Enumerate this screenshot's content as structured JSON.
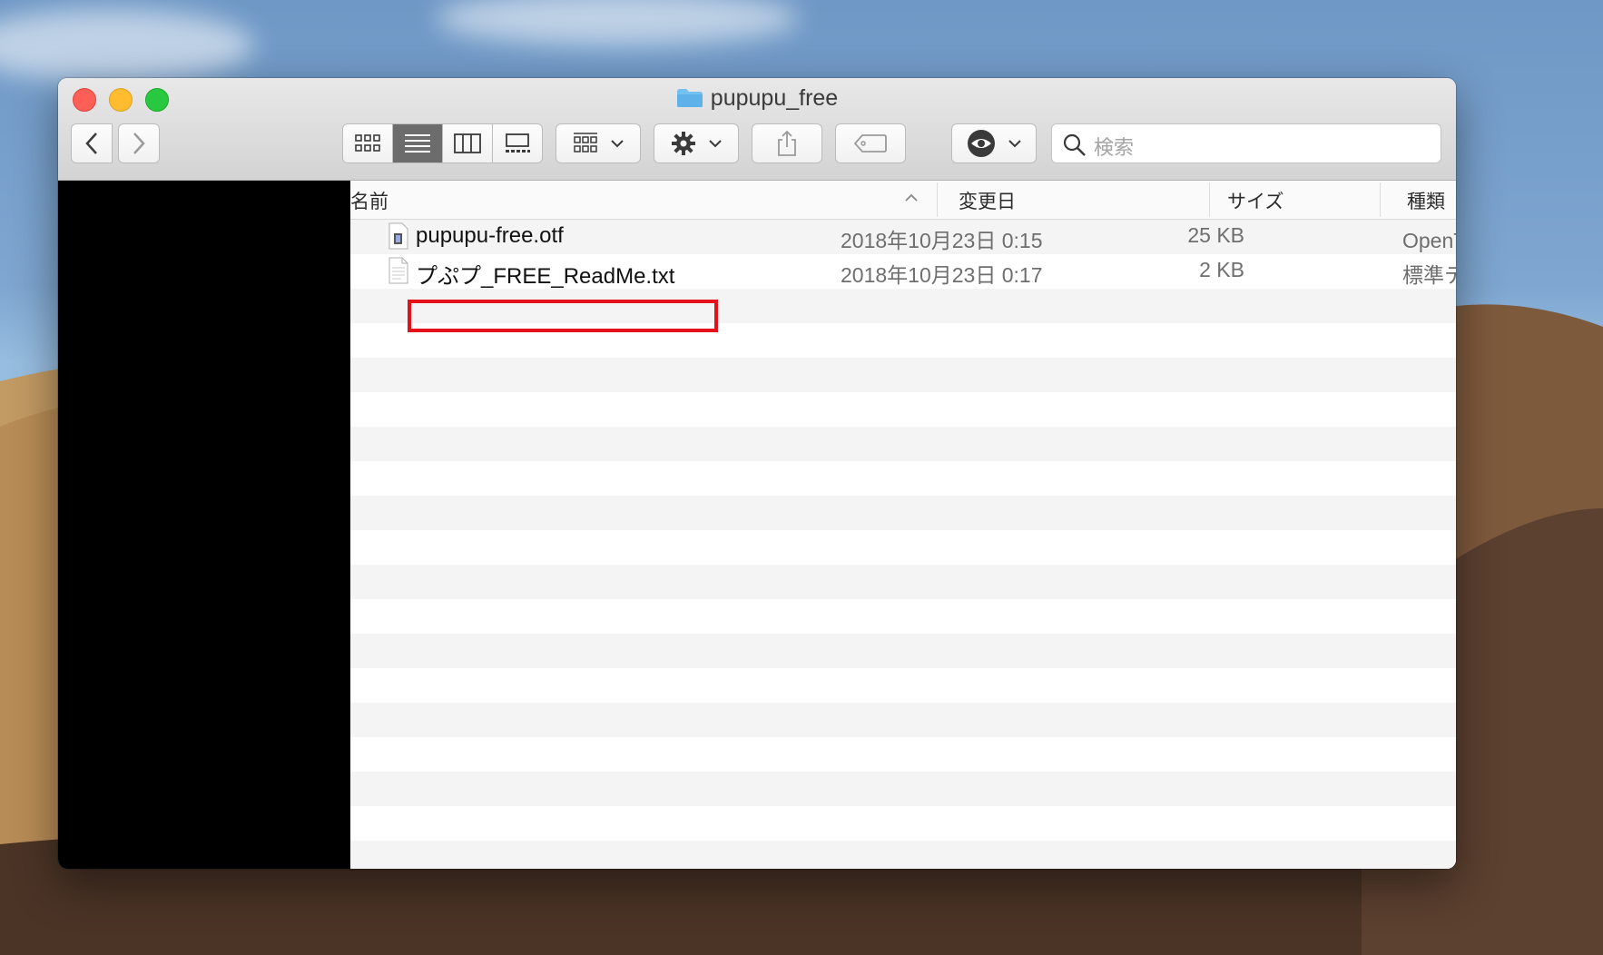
{
  "window": {
    "title": "pupupu_free"
  },
  "toolbar": {
    "back_label": "‹",
    "forward_label": "›",
    "view_modes": [
      "icon-view",
      "list-view",
      "column-view",
      "gallery-view"
    ],
    "active_view": "list-view",
    "search_placeholder": "検索"
  },
  "columns": {
    "name": "名前",
    "modified": "変更日",
    "size": "サイズ",
    "kind": "種類"
  },
  "files": [
    {
      "name": "pupupu-free.otf",
      "modified": "2018年10月23日 0:15",
      "size": "25 KB",
      "kind": "OpenT...フォ"
    },
    {
      "name": "プぷプ_FREE_ReadMe.txt",
      "modified": "2018年10月23日 0:17",
      "size": "2 KB",
      "kind": "標準テキスト"
    }
  ],
  "colors": {
    "highlight": "#e4101a",
    "selected_segment": "#6c6c6c"
  }
}
